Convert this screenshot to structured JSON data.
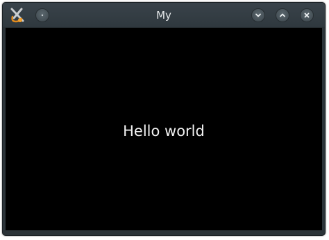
{
  "window": {
    "title": "My",
    "icons": {
      "app": "kde-app-icon",
      "menu": "window-menu-icon",
      "minimize": "chevron-down-icon",
      "maximize": "chevron-up-icon",
      "close": "close-icon"
    }
  },
  "content": {
    "text": "Hello world"
  },
  "colors": {
    "titlebar": "#2f383e",
    "content_background": "#000000",
    "text": "#f2f2f2"
  }
}
